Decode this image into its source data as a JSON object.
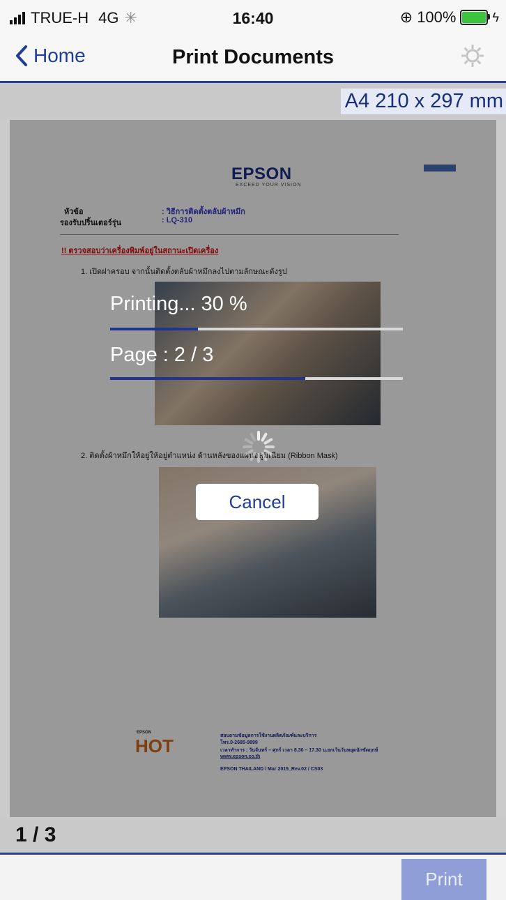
{
  "status_bar": {
    "carrier": "TRUE-H",
    "network": "4G",
    "time": "16:40",
    "battery_percent": "100%",
    "signal_bars": 4
  },
  "nav": {
    "back_label": "Home",
    "title": "Print Documents",
    "settings_icon": "gear-icon"
  },
  "paper": {
    "size_label": "A4 210 x 297 mm"
  },
  "document": {
    "brand": "EPSON",
    "brand_sub": "EXCEED YOUR VISION",
    "fields": [
      {
        "label": "หัวข้อ",
        "value": ": วิธีการติดตั้งตลับผ้าหมึก"
      },
      {
        "label": "รองรับปริ้นเตอร์รุ่น",
        "value": ": LQ-310"
      }
    ],
    "warning": "!! ตรวจสอบว่าเครื่องพิมพ์อยู่ในสถานะเปิดเครื่อง",
    "step1": "1. เปิดฝาครอบ จากนั้นติดตั้งตลับผ้าหมึกลงไปตามลักษณะดังรูป",
    "step2": "2. ติดตั้งผ้าหมึกให้อยู่ให้อยู่ตำแหน่ง ด้านหลังของแผ่นอลูมิเนียม (Ribbon Mask)",
    "footer_logo": "HOT",
    "footer_logo_sub": "EPSON",
    "footer_lines": [
      "สอบถามข้อมูลการใช้งานผลิตภัณฑ์และบริการ",
      "โทร.0-2685-9899",
      "เวลาทำการ : วันจันทร์ – ศุกร์ เวลา 8.30 – 17.30 น.ยกเว้นวันหยุดนักขัตฤกษ์",
      "www.epson.co.th",
      "EPSON THAILAND / Mar 2015_Rev.02 / CS03"
    ]
  },
  "progress": {
    "printing_label": "Printing...  30 %",
    "printing_fraction": 0.3,
    "page_label": "Page : 2 / 3",
    "page_fraction": 0.667,
    "cancel_label": "Cancel"
  },
  "footer": {
    "page_indicator": "1 / 3",
    "print_label": "Print"
  },
  "colors": {
    "accent": "#2b3f8f",
    "link": "#1f3f95",
    "print_button": "#8f9ed6"
  }
}
